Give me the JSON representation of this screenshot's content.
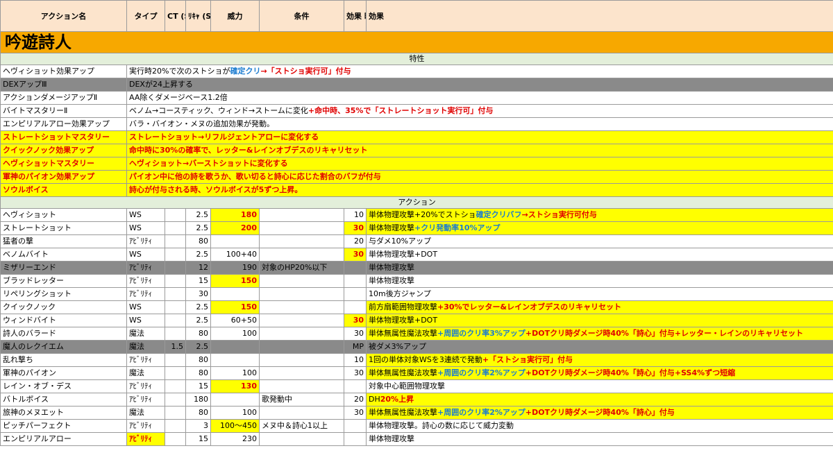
{
  "headers": {
    "action": "アクション名",
    "type": "タイプ",
    "ct": "CT (S)",
    "recast": "ﾘｷｬ (S)",
    "potency": "威力",
    "condition": "条件",
    "duration": "効果 時間 (S)",
    "effect": "効果"
  },
  "job_title": "吟遊詩人",
  "traits_label": "特性",
  "actions_label": "アクション",
  "traits": [
    {
      "name": "ヘヴィショット効果アップ",
      "effect": "実行時20%で次のストショが",
      "eff_blue": "確定クリ",
      "eff_red": "→「ストショ実行可」付与"
    },
    {
      "name": "DEXアップⅢ",
      "effect": "DEXが24上昇する"
    },
    {
      "name": "アクションダメージアップⅡ",
      "effect": "AA除くダメージベース1.2倍"
    },
    {
      "name": "バイトマスタリーⅡ",
      "effect": "ベノム→コースティック、ウィンド→ストームに変化",
      "eff_red": "+命中時、35%で「ストレートショット実行可」付与"
    },
    {
      "name": "エンピリアルアロー効果アップ",
      "effect": "バラ・バイオン・メヌの追加効果が発動。"
    },
    {
      "name": "ストレートショットマスタリー",
      "effect": "ストレートショット→リフルジェントアローに変化する"
    },
    {
      "name": "クイックノック効果アップ",
      "effect": "命中時に30%の確率で、レッター&レインオブデスのリキャリセット"
    },
    {
      "name": "ヘヴィショットマスタリー",
      "effect": "ヘヴィショット→バーストショットに変化する"
    },
    {
      "name": "軍神のパイオン効果アップ",
      "effect": "パイオン中に他の詩を歌うか、歌い切ると詩心に応じた割合のバフが付与"
    },
    {
      "name": "ソウルボイス",
      "effect": "詩心が付与される時、ソウルボイスが5ずつ上昇。"
    }
  ],
  "actions": [
    {
      "name": "ヘヴィショット",
      "type": "WS",
      "ct": "",
      "recast": "2.5",
      "potency": "180",
      "condition": "",
      "duration": "10",
      "effect": "単体物理攻撃+20%でストショ",
      "eff_blue": "確定クリバフ",
      "eff_red": "→ストショ実行可付与"
    },
    {
      "name": "ストレートショット",
      "type": "WS",
      "ct": "",
      "recast": "2.5",
      "potency": "200",
      "condition": "",
      "duration": "30",
      "effect": "単体物理攻撃",
      "eff_blue": "+クリ発動率10%アップ",
      "eff_red": ""
    },
    {
      "name": "猛者の撃",
      "type": "ｱﾋﾞﾘﾃｨ",
      "ct": "",
      "recast": "80",
      "potency": "",
      "condition": "",
      "duration": "20",
      "effect": "与ダメ10%アップ"
    },
    {
      "name": "ベノムバイト",
      "type": "WS",
      "ct": "",
      "recast": "2.5",
      "potency": "100+40",
      "condition": "",
      "duration": "30",
      "effect": "単体物理攻撃+DOT"
    },
    {
      "name": "ミザリーエンド",
      "type": "ｱﾋﾞﾘﾃｨ",
      "ct": "",
      "recast": "12",
      "potency": "190",
      "condition": "対象のHP20%以下",
      "duration": "",
      "effect": "単体物理攻撃"
    },
    {
      "name": "ブラッドレッター",
      "type": "ｱﾋﾞﾘﾃｨ",
      "ct": "",
      "recast": "15",
      "potency": "150",
      "condition": "",
      "duration": "",
      "effect": "単体物理攻撃"
    },
    {
      "name": "リペリングショット",
      "type": "ｱﾋﾞﾘﾃｨ",
      "ct": "",
      "recast": "30",
      "potency": "",
      "condition": "",
      "duration": "",
      "effect": "10m後方ジャンプ"
    },
    {
      "name": "クイックノック",
      "type": "WS",
      "ct": "",
      "recast": "2.5",
      "potency": "150",
      "condition": "",
      "duration": "",
      "effect": "前方扇範囲物理攻撃",
      "eff_red": "+30%でレッター&レインオブデスのリキャリセット"
    },
    {
      "name": "ウィンドバイト",
      "type": "WS",
      "ct": "",
      "recast": "2.5",
      "potency": "60+50",
      "condition": "",
      "duration": "30",
      "effect": "単体物理攻撃+DOT"
    },
    {
      "name": "詩人のバラード",
      "type": "魔法",
      "ct": "",
      "recast": "80",
      "potency": "100",
      "condition": "",
      "duration": "30",
      "effect": "単体無属性魔法攻撃",
      "eff_blue": "+周囲のクリ率3%アップ",
      "eff_tail": "+DOTクリ時ダメージ時40%「詩心」付与+レッター・レインのリキャリセット"
    },
    {
      "name": "魔人のレクイエム",
      "type": "魔法",
      "ct": "1.5",
      "recast": "2.5",
      "potency": "",
      "condition": "",
      "duration": "MP",
      "effect": "被ダメ3%アップ"
    },
    {
      "name": "乱れ撃ち",
      "type": "ｱﾋﾞﾘﾃｨ",
      "ct": "",
      "recast": "80",
      "potency": "",
      "condition": "",
      "duration": "10",
      "effect": "1回の単体対象WSを3連続で発動",
      "eff_red": "+「ストショ実行可」付与"
    },
    {
      "name": "軍神のパイオン",
      "type": "魔法",
      "ct": "",
      "recast": "80",
      "potency": "100",
      "condition": "",
      "duration": "30",
      "effect": "単体無属性魔法攻撃",
      "eff_blue": "+周囲のクリ率2%アップ",
      "eff_tail": "+DOTクリ時ダメージ時40%「詩心」付与+SS4%ずつ短縮"
    },
    {
      "name": "レイン・オブ・デス",
      "type": "ｱﾋﾞﾘﾃｨ",
      "ct": "",
      "recast": "15",
      "potency": "130",
      "condition": "",
      "duration": "",
      "effect": "対象中心範囲物理攻撃"
    },
    {
      "name": "バトルボイス",
      "type": "ｱﾋﾞﾘﾃｨ",
      "ct": "",
      "recast": "180",
      "potency": "",
      "condition": "歌発動中",
      "duration": "20",
      "effect": "DH",
      "eff_red": "20%上昇"
    },
    {
      "name": "旅神のメヌエット",
      "type": "魔法",
      "ct": "",
      "recast": "80",
      "potency": "100",
      "condition": "",
      "duration": "30",
      "effect": "単体無属性魔法攻撃",
      "eff_blue": "+周囲のクリ率2%アップ",
      "eff_tail": "+DOTクリ時ダメージ時40%「詩心」付与"
    },
    {
      "name": "ピッチパーフェクト",
      "type": "ｱﾋﾞﾘﾃｨ",
      "ct": "",
      "recast": "3",
      "potency": "100〜450",
      "condition": "メヌ中＆詩心1以上",
      "duration": "",
      "effect": "単体物理攻撃。詩心の数に応じて威力変動"
    },
    {
      "name": "エンピリアルアロー",
      "type": "ｱﾋﾞﾘﾃｨ",
      "ct": "",
      "recast": "15",
      "potency": "230",
      "condition": "",
      "duration": "",
      "effect": "単体物理攻撃"
    }
  ]
}
